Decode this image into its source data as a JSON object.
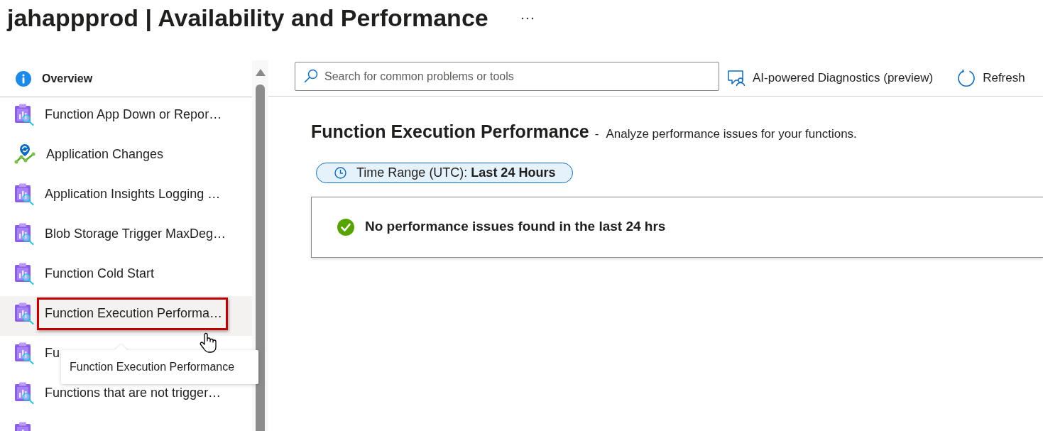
{
  "header": {
    "title": "jahappprod | Availability and Performance"
  },
  "sidebar": {
    "overview": {
      "label": "Overview"
    },
    "items": [
      {
        "label": "Function App Down or Repor…",
        "kind": "report",
        "selected": false,
        "highlighted": false
      },
      {
        "label": "Application Changes",
        "kind": "changes",
        "selected": false,
        "highlighted": false
      },
      {
        "label": "Application Insights Logging …",
        "kind": "report",
        "selected": false,
        "highlighted": false
      },
      {
        "label": "Blob Storage Trigger MaxDeg…",
        "kind": "report",
        "selected": false,
        "highlighted": false
      },
      {
        "label": "Function Cold Start",
        "kind": "report",
        "selected": false,
        "highlighted": false
      },
      {
        "label": "Function Execution Performa…",
        "kind": "report",
        "selected": true,
        "highlighted": true
      },
      {
        "label": "Fu",
        "kind": "report",
        "selected": false,
        "highlighted": false
      },
      {
        "label": "Functions that are not trigger…",
        "kind": "report",
        "selected": false,
        "highlighted": false
      },
      {
        "kind": "report",
        "selected": false,
        "highlighted": false
      }
    ],
    "tooltip": "Function Execution Performance"
  },
  "toolbar": {
    "search": {
      "placeholder": "Search for common problems or tools"
    },
    "actions": [
      {
        "label": "AI-powered Diagnostics (preview)",
        "kind": "diagnostics"
      },
      {
        "label": "Refresh",
        "kind": "refresh"
      }
    ]
  },
  "detector": {
    "title": "Function Execution Performance",
    "separator": "-",
    "description": "Analyze performance issues for your functions.",
    "time_range": "Time Range (UTC): **Last 24 Hours**",
    "status": {
      "kind": "success",
      "message": "No performance issues found in the last 24 hrs"
    }
  }
}
